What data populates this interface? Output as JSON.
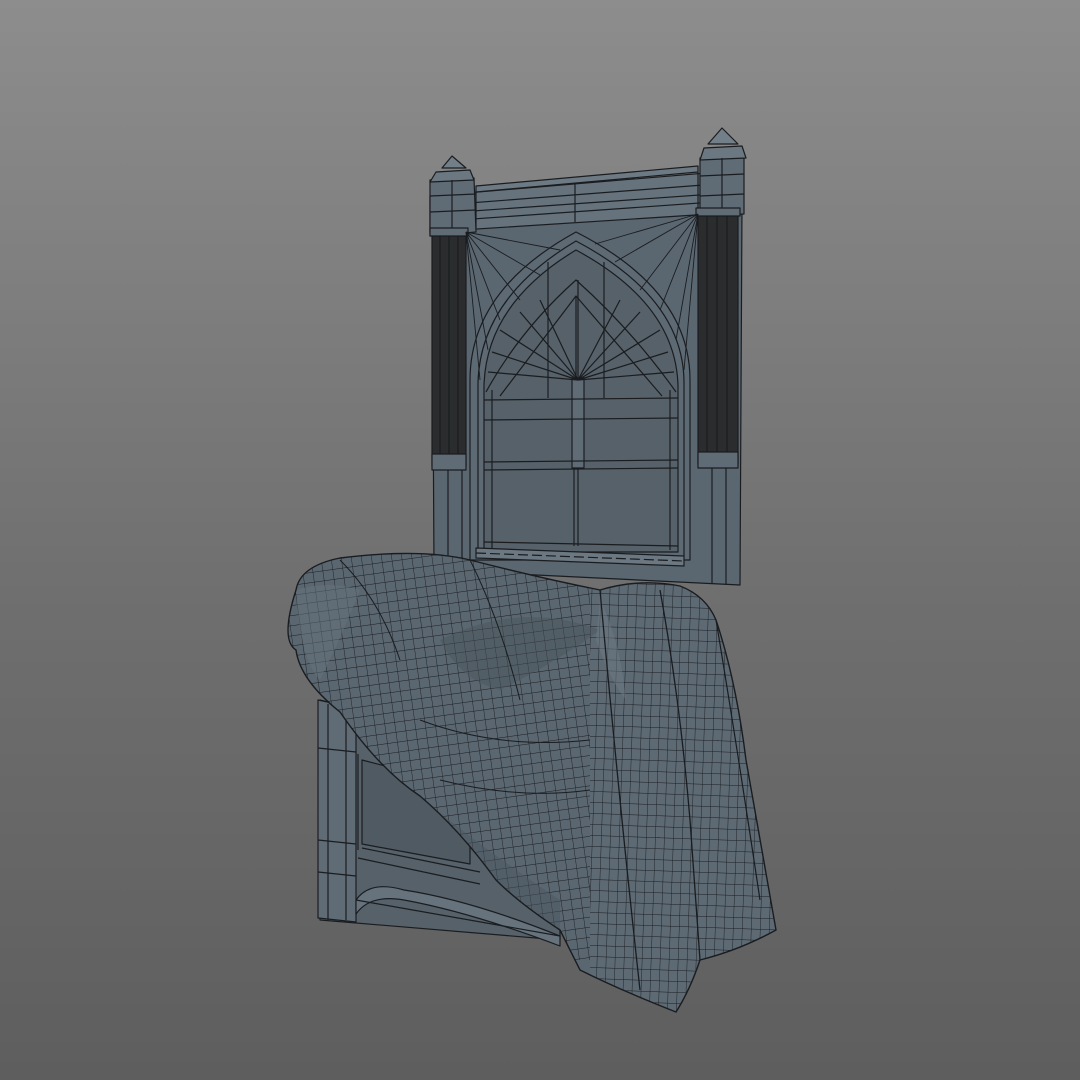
{
  "viewport": {
    "background_top": "#8d8d8d",
    "background_bottom": "#5e5e5e"
  },
  "model": {
    "subject": "wireframe-throne-chair-with-draped-cloth",
    "mesh_fill": "#5a6670",
    "mesh_fill_light": "#66737d",
    "mesh_fill_dark": "#4b565f",
    "wire_color": "#1a1d20",
    "column_color": "#2a2c2e"
  }
}
